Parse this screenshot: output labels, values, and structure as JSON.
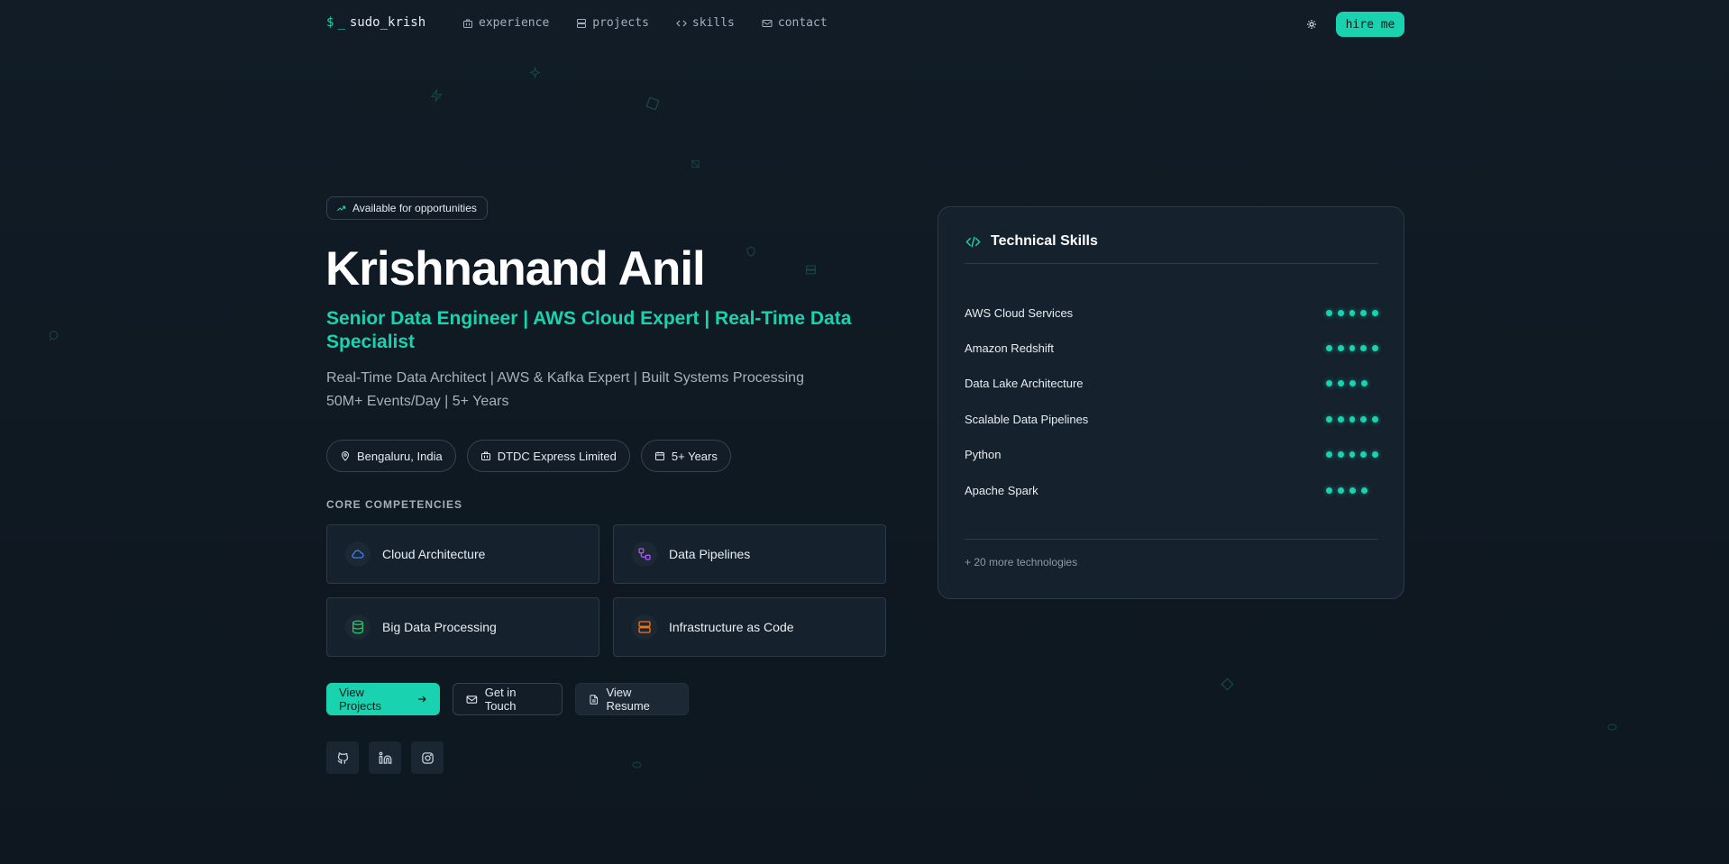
{
  "nav": {
    "logo_prefix": "$",
    "logo_cursor": "_",
    "logo_name": "sudo_krish",
    "links": [
      {
        "label": "experience",
        "icon": "briefcase-icon"
      },
      {
        "label": "projects",
        "icon": "server-icon"
      },
      {
        "label": "skills",
        "icon": "code-icon"
      },
      {
        "label": "contact",
        "icon": "mail-icon"
      }
    ],
    "theme_icon": "sun-icon",
    "hire_label": "hire me"
  },
  "hero": {
    "availability": "Available for opportunities",
    "name": "Krishnanand Anil",
    "headline": "Senior Data Engineer | AWS Cloud Expert | Real-Time Data Specialist",
    "description": "Real-Time Data Architect | AWS & Kafka Expert | Built Systems Processing 50M+ Events/Day | 5+ Years",
    "pills": [
      {
        "label": "Bengaluru, India",
        "icon": "map-pin-icon"
      },
      {
        "label": "DTDC Express Limited",
        "icon": "briefcase-icon"
      },
      {
        "label": "5+ Years",
        "icon": "calendar-icon"
      }
    ],
    "competencies_title": "CORE COMPETENCIES",
    "competencies": [
      {
        "label": "Cloud Architecture",
        "icon": "cloud-icon",
        "color": "#3b82f6"
      },
      {
        "label": "Data Pipelines",
        "icon": "workflow-icon",
        "color": "#a855f7"
      },
      {
        "label": "Big Data Processing",
        "icon": "database-icon",
        "color": "#22c55e"
      },
      {
        "label": "Infrastructure as Code",
        "icon": "server-icon",
        "color": "#f97316"
      }
    ],
    "actions": {
      "primary": "View Projects",
      "contact": "Get in Touch",
      "resume": "View Resume"
    },
    "socials": [
      {
        "name": "github-icon"
      },
      {
        "name": "linkedin-icon"
      },
      {
        "name": "instagram-icon"
      }
    ]
  },
  "skills": {
    "title": "Technical Skills",
    "items": [
      {
        "label": "AWS Cloud Services",
        "level": 5
      },
      {
        "label": "Amazon Redshift",
        "level": 5
      },
      {
        "label": "Data Lake Architecture",
        "level": 4
      },
      {
        "label": "Scalable Data Pipelines",
        "level": 5
      },
      {
        "label": "Python",
        "level": 5
      },
      {
        "label": "Apache Spark",
        "level": 4
      }
    ],
    "more": "+ 20 more technologies"
  },
  "colors": {
    "accent": "#19d3b0",
    "background": "#0f1922",
    "card": "#15212c"
  }
}
